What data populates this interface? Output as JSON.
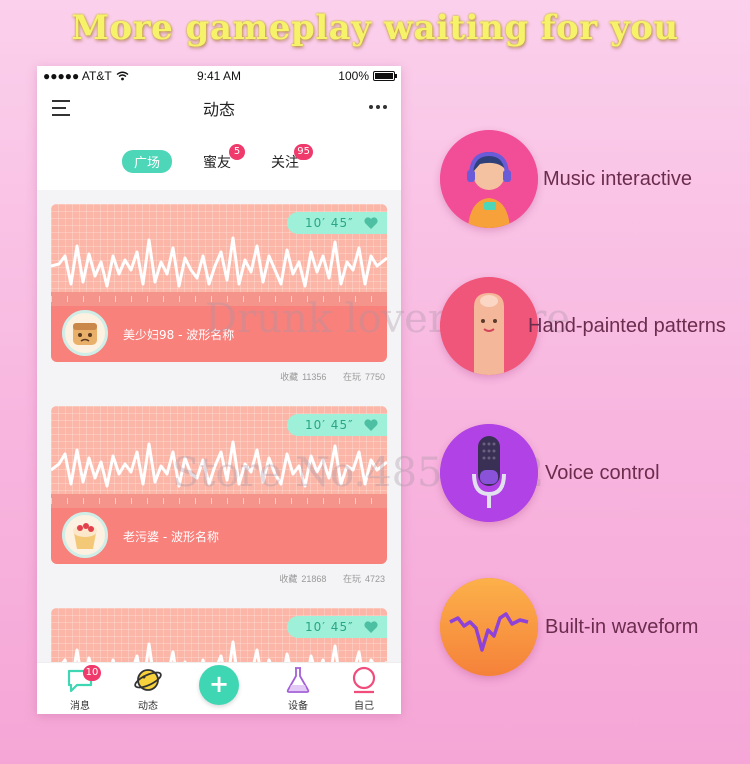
{
  "headline": "More gameplay waiting for you",
  "watermark": {
    "line1": "Drunk lover Store",
    "line2": "Store No.4850102"
  },
  "statusbar": {
    "carrier": "●●●●● AT&T",
    "time": "9:41 AM",
    "battery": "100%"
  },
  "navbar": {
    "title": "动态",
    "menu_icon": "hamburger-menu-icon",
    "more_icon": "ellipsis-icon"
  },
  "tabs": [
    {
      "label": "广场",
      "active": true
    },
    {
      "label": "蜜友",
      "badge": "5"
    },
    {
      "label": "关注",
      "badge": "95"
    }
  ],
  "cards": [
    {
      "duration": "10′ 45″",
      "name": "美少妇98 - 波形名称",
      "fav_label": "收藏",
      "fav_count": "11356",
      "play_label": "在玩",
      "play_count": "7750"
    },
    {
      "duration": "10′ 45″",
      "name": "老污婆 - 波形名称",
      "fav_label": "收藏",
      "fav_count": "21868",
      "play_label": "在玩",
      "play_count": "4723"
    },
    {
      "duration": "10′ 45″"
    }
  ],
  "bottombar": {
    "messages": {
      "label": "消息",
      "badge": "10"
    },
    "feed": {
      "label": "动态"
    },
    "add": {
      "label": "+"
    },
    "devices": {
      "label": "设备"
    },
    "me": {
      "label": "自己"
    }
  },
  "features": [
    {
      "label": "Music interactive",
      "icon": "headphones-girl-icon",
      "color": "#f24e97"
    },
    {
      "label": "Hand-painted patterns",
      "icon": "finger-face-icon",
      "color": "#f0567a"
    },
    {
      "label": "Voice control",
      "icon": "microphone-icon",
      "color": "#b042e6"
    },
    {
      "label": "Built-in waveform",
      "icon": "waveform-icon",
      "color": "#f7913a"
    }
  ],
  "colors": {
    "accent": "#4dd6b8",
    "card": "#f8817c",
    "badge": "#ef3a6b"
  }
}
